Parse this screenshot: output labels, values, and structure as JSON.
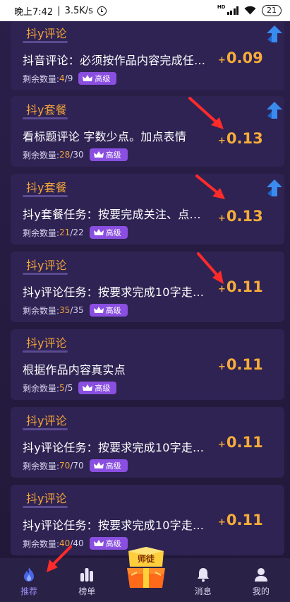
{
  "status_bar": {
    "time": "晚上7:42",
    "speed": "3.5K/s",
    "network": "HD",
    "battery": "21"
  },
  "remain_label": "剩余数量:",
  "tasks": [
    {
      "category": "抖y评论",
      "title": "抖音评论：必须按作品内容完成任…",
      "remain": "4",
      "total": "9",
      "badge": "高级",
      "price_sign": "+",
      "price": "0.09",
      "up_arrow": true
    },
    {
      "category": "抖y套餐",
      "title": "看标题评论 字数少点。加点表情",
      "remain": "28",
      "total": "30",
      "badge": "高级",
      "price_sign": "+",
      "price": "0.13",
      "up_arrow": true
    },
    {
      "category": "抖y套餐",
      "title": "抖y套餐任务：按要完成关注、点…",
      "remain": "21",
      "total": "22",
      "badge": "高级",
      "price_sign": "+",
      "price": "0.13",
      "up_arrow": true
    },
    {
      "category": "抖y评论",
      "title": "抖y评论任务：按要求完成10字走…",
      "remain": "35",
      "total": "35",
      "badge": "高级",
      "price_sign": "+",
      "price": "0.11",
      "up_arrow": false
    },
    {
      "category": "抖y评论",
      "title": "根据作品内容真实点",
      "remain": "5",
      "total": "5",
      "badge": "高级",
      "price_sign": "+",
      "price": "0.11",
      "up_arrow": false
    },
    {
      "category": "抖y评论",
      "title": "抖y评论任务：按要求完成10字走…",
      "remain": "70",
      "total": "70",
      "badge": "高级",
      "price_sign": "+",
      "price": "0.11",
      "up_arrow": false
    },
    {
      "category": "抖y评论",
      "title": "抖y评论任务：按要求完成10字走…",
      "remain": "40",
      "total": "40",
      "badge": "高级",
      "price_sign": "+",
      "price": "0.11",
      "up_arrow": false
    }
  ],
  "bottom_nav": {
    "recommend": "推荐",
    "ranking": "榜单",
    "master": "师徒",
    "messages": "消息",
    "mine": "我的"
  },
  "colors": {
    "accent_orange": "#f6ac3a",
    "badge_purple": "#8a4fe0",
    "card_bg": "#2e2353",
    "annotation_red": "#ff2a2a"
  }
}
